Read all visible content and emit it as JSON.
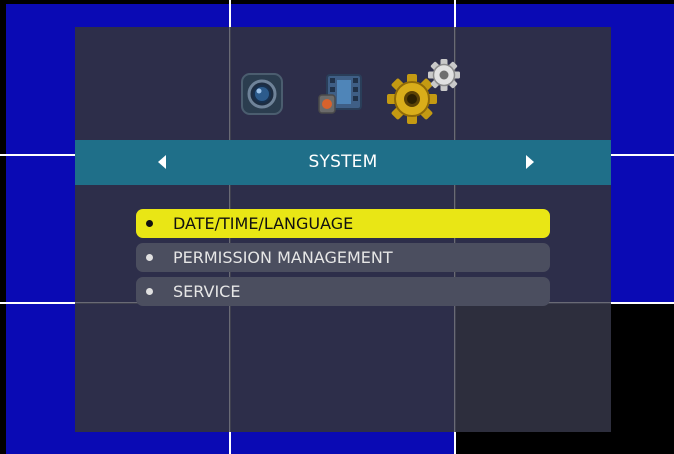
{
  "menu": {
    "title": "SYSTEM",
    "icons": [
      "camera-icon",
      "record-icon",
      "gear-icon"
    ],
    "items": [
      {
        "label": "DATE/TIME/LANGUAGE",
        "selected": true
      },
      {
        "label": "PERMISSION MANAGEMENT",
        "selected": false
      },
      {
        "label": "SERVICE",
        "selected": false
      }
    ]
  },
  "colors": {
    "video_background": "#0a0ab4",
    "title_bar": "#1f6f89",
    "selected_item": "#e9e615",
    "item_background": "#4b4e5f"
  }
}
